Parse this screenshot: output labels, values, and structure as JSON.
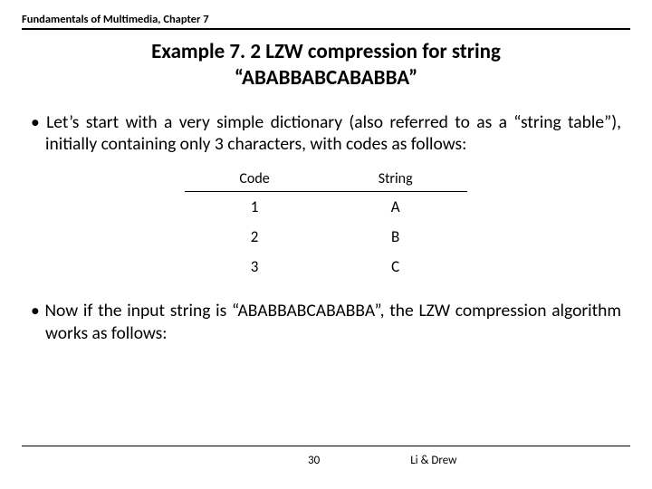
{
  "header": {
    "chapter": "Fundamentals of Multimedia, Chapter 7"
  },
  "title": "Example 7. 2 LZW compression for string “ABABBABCABABBA”",
  "bullets": {
    "p1": "Let’s start with a very simple dictionary (also referred to as a “string table”), initially containing only 3 characters, with codes as follows:",
    "p2": "Now if the input string is “ABABBABCABABBA”, the LZW compression algorithm works as follows:"
  },
  "table": {
    "headers": {
      "code": "Code",
      "string": "String"
    },
    "rows": [
      {
        "code": "1",
        "string": "A"
      },
      {
        "code": "2",
        "string": "B"
      },
      {
        "code": "3",
        "string": "C"
      }
    ]
  },
  "footer": {
    "page": "30",
    "authors": "Li & Drew"
  }
}
